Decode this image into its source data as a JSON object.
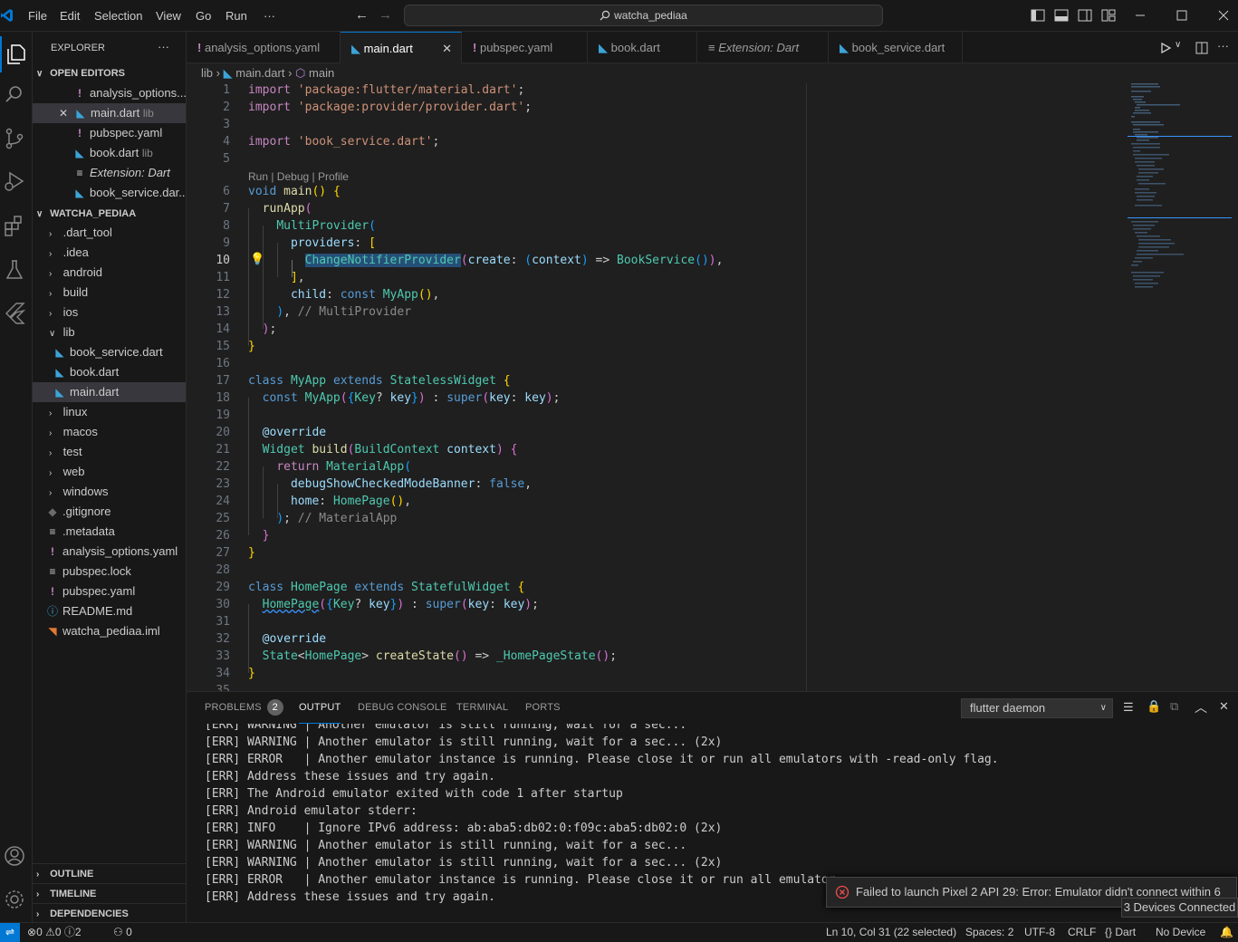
{
  "titlebar": {
    "menus": [
      "File",
      "Edit",
      "Selection",
      "View",
      "Go",
      "Run",
      "···"
    ],
    "search": "watcha_pediaa"
  },
  "sidebar": {
    "explorer_title": "EXPLORER",
    "more": "···",
    "open_editors_title": "OPEN EDITORS",
    "open_editors": [
      {
        "name": "analysis_options...",
        "type": "yaml",
        "hint": ""
      },
      {
        "name": "main.dart",
        "type": "dart",
        "hint": "lib"
      },
      {
        "name": "pubspec.yaml",
        "type": "yaml",
        "hint": ""
      },
      {
        "name": "book.dart",
        "type": "dart",
        "hint": "lib"
      },
      {
        "name": "Extension: Dart",
        "type": "ext",
        "hint": ""
      },
      {
        "name": "book_service.dar...",
        "type": "dart",
        "hint": ""
      }
    ],
    "project_title": "WATCHA_PEDIAA",
    "tree": [
      ".dart_tool",
      ".idea",
      "android",
      "build",
      "ios",
      "lib",
      "book_service.dart",
      "book.dart",
      "main.dart",
      "linux",
      "macos",
      "test",
      "web",
      "windows",
      ".gitignore",
      ".metadata",
      "analysis_options.yaml",
      "pubspec.lock",
      "pubspec.yaml",
      "README.md",
      "watcha_pediaa.iml"
    ],
    "outline": "OUTLINE",
    "timeline": "TIMELINE",
    "dependencies": "DEPENDENCIES"
  },
  "tabs": [
    "analysis_options.yaml",
    "main.dart",
    "pubspec.yaml",
    "book.dart",
    "Extension: Dart",
    "book_service.dart"
  ],
  "breadcrumb": {
    "folder": "lib",
    "file": "main.dart",
    "symbol": "main"
  },
  "editor": {
    "codelens": "Run | Debug | Profile",
    "line_numbers": [
      "1",
      "2",
      "3",
      "4",
      "5",
      "6",
      "7",
      "8",
      "9",
      "10",
      "11",
      "12",
      "13",
      "14",
      "15",
      "16",
      "17",
      "18",
      "19",
      "20",
      "21",
      "22",
      "23",
      "24",
      "25",
      "26",
      "27",
      "28",
      "29",
      "30",
      "31",
      "32",
      "33",
      "34",
      "35"
    ]
  },
  "panel": {
    "tabs": [
      "PROBLEMS",
      "OUTPUT",
      "DEBUG CONSOLE",
      "TERMINAL",
      "PORTS"
    ],
    "problems_count": "2",
    "channel": "flutter daemon",
    "output": [
      "[ERR] WARNING | Another emulator is still running, wait for a sec...",
      "[ERR] WARNING | Another emulator is still running, wait for a sec... (2x)",
      "[ERR] ERROR   | Another emulator instance is running. Please close it or run all emulators with -read-only flag.",
      "[ERR] Address these issues and try again.",
      "[ERR] The Android emulator exited with code 1 after startup",
      "[ERR] Android emulator stderr:",
      "[ERR] INFO    | Ignore IPv6 address: ab:aba5:db02:0:f09c:aba5:db02:0 (2x)",
      "[ERR] WARNING | Another emulator is still running, wait for a sec...",
      "[ERR] WARNING | Another emulator is still running, wait for a sec... (2x)",
      "[ERR] ERROR   | Another emulator instance is running. Please close it or run all emulator",
      "[ERR] Address these issues and try again."
    ]
  },
  "notification": {
    "text": "Failed to launch Pixel 2 API 29: Error: Emulator didn't connect within 6",
    "tooltip": "3 Devices Connected"
  },
  "status": {
    "errors": "0",
    "warnings": "0",
    "info": "2",
    "ports": "0",
    "position": "Ln 10, Col 31 (22 selected)",
    "spaces": "Spaces: 2",
    "encoding": "UTF-8",
    "eol": "CRLF",
    "language": "Dart",
    "device": "No Device"
  },
  "colors": {
    "accent": "#0078d4",
    "error": "#f14c4c",
    "background": "#1f1f1f"
  }
}
